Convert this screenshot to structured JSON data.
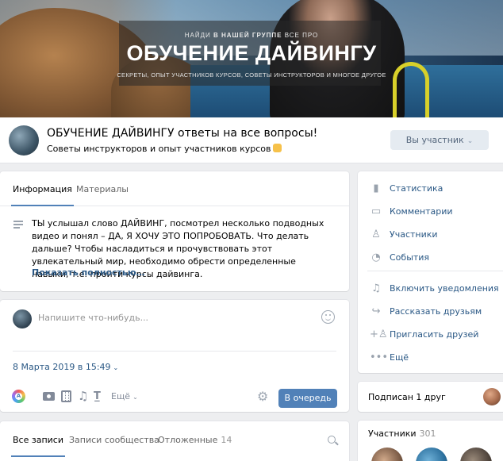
{
  "cover": {
    "kicker_prefix": "НАЙДИ ",
    "kicker_bold": "В НАШЕЙ ГРУППЕ",
    "kicker_suffix": " ВСЕ ПРО",
    "headline": "ОБУЧЕНИЕ ДАЙВИНГУ",
    "tagline": "СЕКРЕТЫ, ОПЫТ УЧАСТНИКОВ КУРСОВ, СОВЕТЫ ИНСТРУКТОРОВ И МНОГОЕ ДРУГОЕ"
  },
  "group": {
    "name": "ОБУЧЕНИЕ ДАЙВИНГУ ответы на все вопросы!",
    "status": "Советы инструкторов и опыт участников курсов",
    "member_button": "Вы участник",
    "member_chevron": "⌄"
  },
  "info": {
    "tabs": [
      {
        "label": "Информация",
        "active": true
      },
      {
        "label": "Материалы",
        "active": false
      }
    ],
    "description": "ТЫ услышал слово ДАЙВИНГ, посмотрел несколько подводных видео и понял – ДА, Я ХОЧУ ЭТО ПОПРОБОВАТЬ. Что делать дальше? Чтобы насладиться и прочувствовать этот увлекательный мир, необходимо обрести определенные навыки, т.е. пройти курсы дайвинга.",
    "show_more": "Показать полностью…"
  },
  "composer": {
    "placeholder": "Напишите что-нибудь...",
    "date": "8 Марта 2019 в 15:49",
    "date_chevron": "⌄",
    "more": "Ещё",
    "more_chevron": "⌄",
    "color_label": "A",
    "submit": "В очередь"
  },
  "wall": {
    "tabs": [
      {
        "label": "Все записи",
        "count": ""
      },
      {
        "label": "Записи сообщества",
        "count": ""
      },
      {
        "label": "Отложенные",
        "count": "14"
      }
    ]
  },
  "sidebar": {
    "items": [
      {
        "label": "Статистика",
        "icon": "bar-chart-icon"
      },
      {
        "label": "Комментарии",
        "icon": "comment-icon"
      },
      {
        "label": "Участники",
        "icon": "user-icon"
      },
      {
        "label": "События",
        "icon": "event-icon"
      },
      {
        "label": "Включить уведомления",
        "icon": "bell-icon"
      },
      {
        "label": "Рассказать друзьям",
        "icon": "share-icon"
      },
      {
        "label": "Пригласить друзей",
        "icon": "invite-icon"
      },
      {
        "label": "Ещё",
        "icon": "more-icon"
      }
    ],
    "friends": "Подписан 1 друг",
    "members_label": "Участники",
    "members_count": "301"
  },
  "colors": {
    "accent": "#5181b8",
    "link": "#2a5885",
    "background": "#edeef0"
  }
}
